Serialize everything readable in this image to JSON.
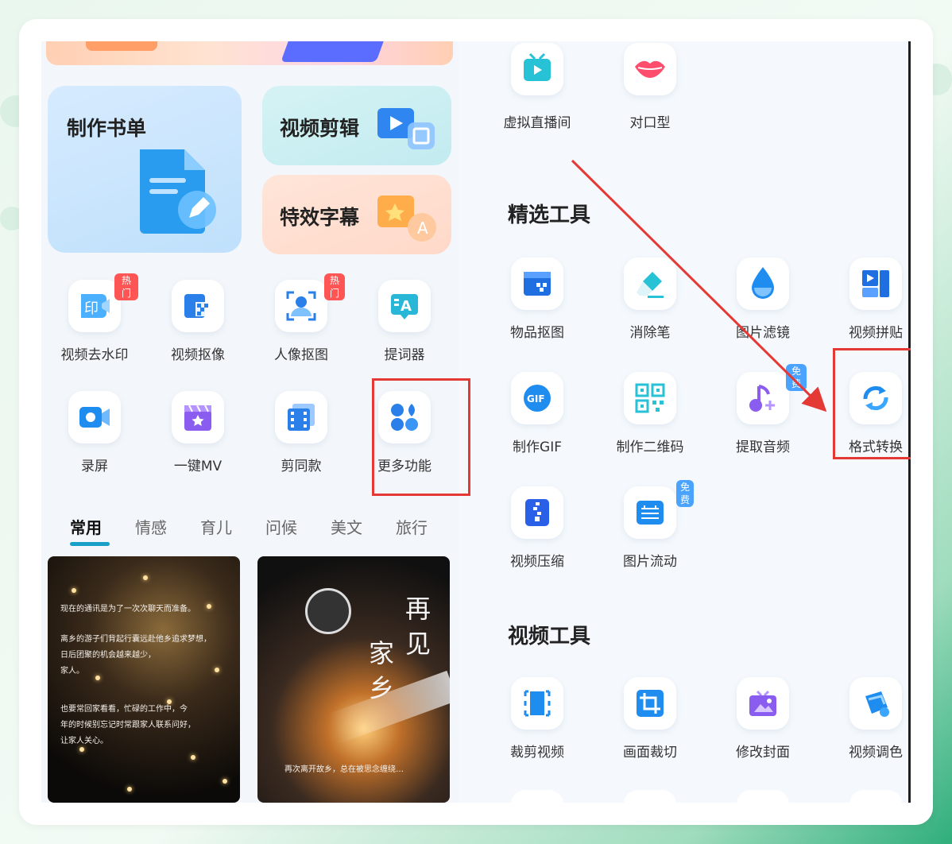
{
  "left": {
    "big_tiles": {
      "book": "制作书单",
      "video_edit": "视频剪辑",
      "effect_sub": "特效字幕"
    },
    "row1": [
      {
        "label": "视频去水印",
        "badge": "热门",
        "icon": "watermark-remove-icon"
      },
      {
        "label": "视频抠像",
        "badge": "",
        "icon": "video-cutout-icon"
      },
      {
        "label": "人像抠图",
        "badge": "热门",
        "icon": "portrait-cutout-icon"
      },
      {
        "label": "提词器",
        "badge": "",
        "icon": "teleprompter-icon"
      }
    ],
    "row2": [
      {
        "label": "录屏",
        "icon": "screen-record-icon"
      },
      {
        "label": "一键MV",
        "icon": "one-click-mv-icon"
      },
      {
        "label": "剪同款",
        "icon": "template-edit-icon"
      },
      {
        "label": "更多功能",
        "icon": "more-features-icon"
      }
    ],
    "tabs": [
      "常用",
      "情感",
      "育儿",
      "问候",
      "美文",
      "旅行"
    ],
    "active_tab": "常用",
    "photo1_text": [
      "现在的通讯是为了一次次聊天而准备。",
      "离乡的游子们背起行囊远赴他乡追求梦想，",
      "日后团聚的机会越来越少，",
      "家人。",
      "也要常回家看看，忙碌的工作中，今",
      "年的时候别忘记时常跟家人联系问好，",
      "让家人关心。"
    ],
    "photo2_poem": [
      "再",
      "见",
      "家",
      "乡"
    ],
    "photo2_caption": "再次离开故乡，总在被思念缠绕…"
  },
  "right": {
    "top_row": [
      {
        "label": "虚拟直播间",
        "icon": "virtual-live-icon"
      },
      {
        "label": "对口型",
        "icon": "lip-sync-icon"
      }
    ],
    "section1_title": "精选工具",
    "section1_row1": [
      {
        "label": "物品抠图",
        "icon": "object-cutout-icon"
      },
      {
        "label": "消除笔",
        "icon": "eraser-pen-icon"
      },
      {
        "label": "图片滤镜",
        "icon": "image-filter-icon"
      },
      {
        "label": "视频拼贴",
        "icon": "video-collage-icon"
      }
    ],
    "section1_row2": [
      {
        "label": "制作GIF",
        "icon": "gif-icon",
        "badge": ""
      },
      {
        "label": "制作二维码",
        "icon": "qr-code-icon",
        "badge": ""
      },
      {
        "label": "提取音频",
        "icon": "extract-audio-icon",
        "badge": "免费"
      },
      {
        "label": "格式转换",
        "icon": "format-convert-icon",
        "badge": ""
      }
    ],
    "section1_row3": [
      {
        "label": "视频压缩",
        "icon": "video-compress-icon",
        "badge": ""
      },
      {
        "label": "图片流动",
        "icon": "image-flow-icon",
        "badge": "免费"
      }
    ],
    "section2_title": "视频工具",
    "section2_row1": [
      {
        "label": "裁剪视频",
        "icon": "trim-video-icon"
      },
      {
        "label": "画面裁切",
        "icon": "crop-frame-icon"
      },
      {
        "label": "修改封面",
        "icon": "edit-cover-icon"
      },
      {
        "label": "视频调色",
        "icon": "color-grade-icon"
      }
    ]
  },
  "colors": {
    "highlight": "#e53935",
    "tab_active": "#19a0c9",
    "hot_badge": "#ff5555",
    "free_badge": "#4aa3ff"
  }
}
